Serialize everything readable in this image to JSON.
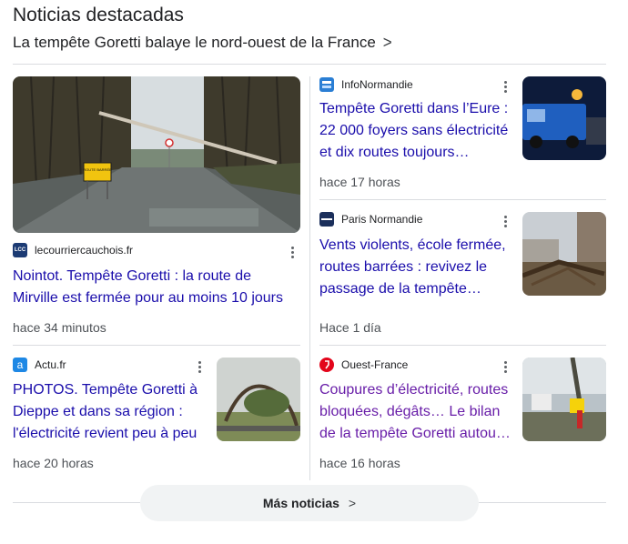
{
  "header": {
    "title": "Noticias destacadas",
    "subtitle": "La tempête Goretti balaye le nord-ouest de la France"
  },
  "featured": {
    "source": "lecourriercauchois.fr",
    "logo_text": "LCC",
    "logo_color": "#1c3b74",
    "headline": "Nointot. Tempête Goretti : la route de Mirville est fermée pour au moins 10 jours",
    "time": "hace 34 minutos",
    "image_sign": "ROUTE BARRÉE"
  },
  "right_articles": [
    {
      "source": "InfoNormandie",
      "logo_color": "#2a7ed4",
      "headline": "Tempête Goretti dans l’Eure : 22 000 foyers sans électricité et dix routes toujours…",
      "time": "hace 17 horas",
      "visited": false
    },
    {
      "source": "Paris Normandie",
      "logo_color": "#1b2f5b",
      "headline": "Vents violents, école fermée, routes barrées : revivez le passage de la tempête…",
      "time": "Hace 1 día",
      "visited": false
    },
    {
      "source": "Ouest-France",
      "logo_color": "#e3051b",
      "headline": "Coupures d’électricité, routes bloquées, dégâts… Le bilan de la tempête Goretti autou…",
      "time": "hace 16 horas",
      "visited": true
    }
  ],
  "left_article": {
    "source": "Actu.fr",
    "logo_text": "a",
    "logo_color": "#1e88e5",
    "headline": "PHOTOS. Tempête Goretti à Dieppe et dans sa région : l'électricité revient peu à peu",
    "time": "hace 20 horas"
  },
  "more_button": {
    "label": "Más noticias"
  },
  "icons": {
    "chevron": "›",
    "kebab": "kebab-menu-icon"
  }
}
